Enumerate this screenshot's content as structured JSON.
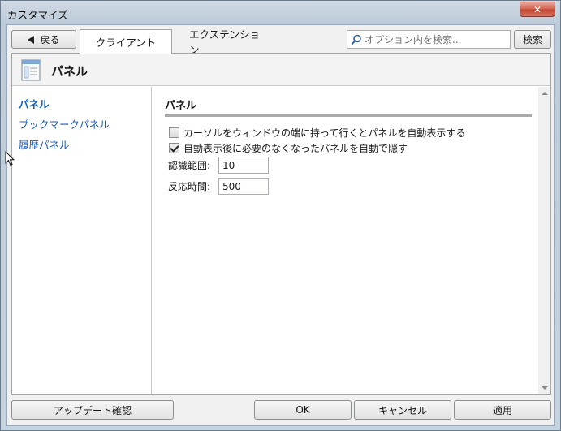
{
  "window": {
    "title": "カスタマイズ",
    "close_label": "✕"
  },
  "toolbar": {
    "back_label": "戻る",
    "tabs": [
      {
        "label": "クライアント"
      },
      {
        "label": "エクステンション"
      }
    ],
    "search_placeholder": "オプション内を検索...",
    "search_button_label": "検索"
  },
  "header": {
    "title": "パネル",
    "icon": "panel-icon"
  },
  "sidebar": {
    "items": [
      {
        "label": "パネル"
      },
      {
        "label": "ブックマークパネル"
      },
      {
        "label": "履歴パネル"
      }
    ]
  },
  "content": {
    "section_title": "パネル",
    "checkboxes": [
      {
        "label": "カーソルをウィンドウの端に持って行くとパネルを自動表示する",
        "checked": false
      },
      {
        "label": "自動表示後に必要のなくなったパネルを自動で隠す",
        "checked": true
      }
    ],
    "fields": [
      {
        "label": "認識範囲:",
        "value": "10"
      },
      {
        "label": "反応時間:",
        "value": "500"
      }
    ]
  },
  "footer": {
    "update_label": "アップデート確認",
    "ok_label": "OK",
    "cancel_label": "キャンセル",
    "apply_label": "適用"
  },
  "colors": {
    "link": "#1a5cb8",
    "title_bar": "#cfd9e4",
    "close_button": "#c1442f"
  }
}
